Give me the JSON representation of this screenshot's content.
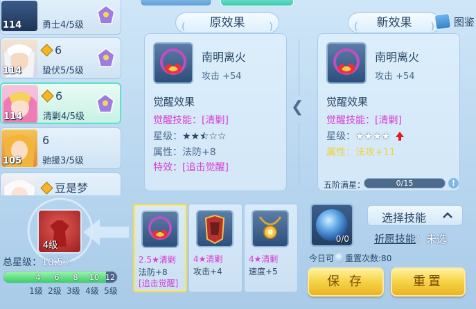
{
  "heroes": [
    {
      "level": "114",
      "stars": "",
      "type": "勇士4/5级"
    },
    {
      "level": "114",
      "stars": "6",
      "type": "蛰伏5/5级"
    },
    {
      "level": "114",
      "stars": "6",
      "type": "清剿4/5级"
    },
    {
      "level": "105",
      "stars": "6",
      "type": "驰援3/5级"
    },
    {
      "level": "",
      "stars": "豆是梦",
      "type": ""
    }
  ],
  "original": {
    "title": "原效果",
    "item_name": "南明离火",
    "item_attack": "攻击 +54",
    "section": "觉醒效果",
    "skill": "觉醒技能：[清剿]",
    "star_label": "星级：",
    "stars": "★★⯪☆☆",
    "attr": "属性：法防+8",
    "special": "特效：[追击觉醒]"
  },
  "new": {
    "title": "新效果",
    "item_name": "南明离火",
    "item_attack": "攻击 +54",
    "section": "觉醒效果",
    "skill": "觉醒技能：[清剿]",
    "star_label": "星级：",
    "stars": "★★★★",
    "attr": "属性：法攻+11",
    "five_star_label": "五阶满星：",
    "five_star_progress": "0/15",
    "five_star_fraction": 0
  },
  "tujian": "图鉴",
  "hero_skill_level": "4级",
  "total_star_label": "总星级：",
  "total_star_value": "10.5☆",
  "star_track": {
    "ticks": [
      "4",
      "6",
      "8",
      "10",
      "12"
    ],
    "levels": [
      "1级",
      "2级",
      "3级",
      "4级",
      "5级"
    ],
    "fill_fraction": 0.9
  },
  "slots": [
    {
      "line1": "2.5★清剿",
      "line2": "法防+8",
      "line3": "[追击觉醒]"
    },
    {
      "line1": "4★清剿",
      "line2": "攻击+4",
      "line3": ""
    },
    {
      "line1": "4★清剿",
      "line2": "速度+5",
      "line3": ""
    }
  ],
  "orb_count": "0/0",
  "today_prefix": "今日可",
  "today_suffix": "重置次数:80",
  "select_skill_label": "选择技能",
  "wish_label": "祈愿技能",
  "wish_value": "：未选",
  "save_label": "保 存",
  "reset_label": "重置",
  "colors": {
    "accent_magenta": "#d53fd4",
    "accent_yellow": "#f0d23a",
    "button_gold": "#f7d54a",
    "selected_border": "#5fe0c9"
  }
}
